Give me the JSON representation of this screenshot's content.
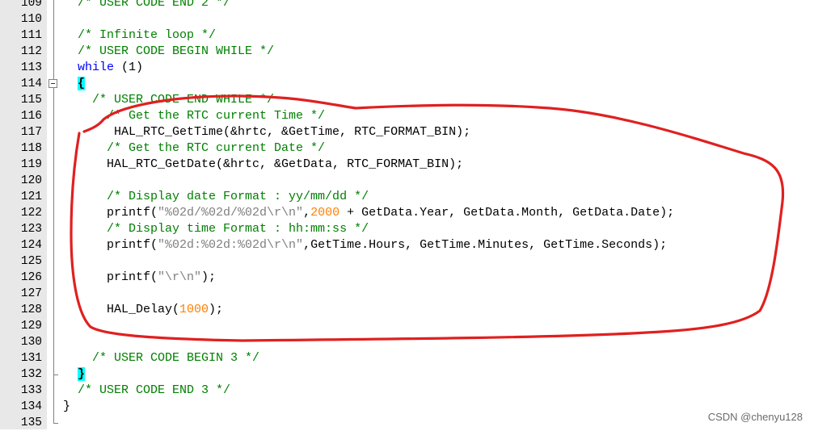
{
  "lines": [
    {
      "num": "109",
      "indent": "  ",
      "html": [
        {
          "c": "cm",
          "t": "/* USER CODE END 2 */"
        }
      ]
    },
    {
      "num": "110",
      "indent": "",
      "html": []
    },
    {
      "num": "111",
      "indent": "  ",
      "html": [
        {
          "c": "cm",
          "t": "/* Infinite loop */"
        }
      ]
    },
    {
      "num": "112",
      "indent": "  ",
      "html": [
        {
          "c": "cm",
          "t": "/* USER CODE BEGIN WHILE */"
        }
      ]
    },
    {
      "num": "113",
      "indent": "  ",
      "html": [
        {
          "c": "kw",
          "t": "while"
        },
        {
          "c": "",
          "t": " (1)"
        }
      ]
    },
    {
      "num": "114",
      "indent": "  ",
      "html": [
        {
          "c": "brace-hl",
          "t": "{"
        }
      ]
    },
    {
      "num": "115",
      "indent": "    ",
      "html": [
        {
          "c": "cm",
          "t": "/* USER CODE END WHILE */"
        }
      ]
    },
    {
      "num": "116",
      "indent": "      ",
      "html": [
        {
          "c": "cm",
          "t": "/* Get the RTC current Time */"
        }
      ]
    },
    {
      "num": "117",
      "indent": "       ",
      "html": [
        {
          "c": "",
          "t": "HAL_RTC_GetTime(&hrtc, &GetTime, RTC_FORMAT_BIN);"
        }
      ]
    },
    {
      "num": "118",
      "indent": "      ",
      "html": [
        {
          "c": "cm",
          "t": "/* Get the RTC current Date */"
        }
      ]
    },
    {
      "num": "119",
      "indent": "      ",
      "html": [
        {
          "c": "",
          "t": "HAL_RTC_GetDate(&hrtc, &GetData, RTC_FORMAT_BIN);"
        }
      ]
    },
    {
      "num": "120",
      "indent": "",
      "html": []
    },
    {
      "num": "121",
      "indent": "      ",
      "html": [
        {
          "c": "cm",
          "t": "/* Display date Format : yy/mm/dd */"
        }
      ]
    },
    {
      "num": "122",
      "indent": "      ",
      "html": [
        {
          "c": "",
          "t": "printf("
        },
        {
          "c": "str",
          "t": "\"%02d/%02d/%02d\\r\\n\""
        },
        {
          "c": "",
          "t": ","
        },
        {
          "c": "num",
          "t": "2000"
        },
        {
          "c": "",
          "t": " + GetData.Year, GetData.Month, GetData.Date);"
        }
      ]
    },
    {
      "num": "123",
      "indent": "      ",
      "html": [
        {
          "c": "cm",
          "t": "/* Display time Format : hh:mm:ss */"
        }
      ]
    },
    {
      "num": "124",
      "indent": "      ",
      "html": [
        {
          "c": "",
          "t": "printf("
        },
        {
          "c": "str",
          "t": "\"%02d:%02d:%02d\\r\\n\""
        },
        {
          "c": "",
          "t": ",GetTime.Hours, GetTime.Minutes, GetTime.Seconds);"
        }
      ]
    },
    {
      "num": "125",
      "indent": "",
      "html": []
    },
    {
      "num": "126",
      "indent": "      ",
      "html": [
        {
          "c": "",
          "t": "printf("
        },
        {
          "c": "str",
          "t": "\"\\r\\n\""
        },
        {
          "c": "",
          "t": ");"
        }
      ]
    },
    {
      "num": "127",
      "indent": "",
      "html": []
    },
    {
      "num": "128",
      "indent": "      ",
      "html": [
        {
          "c": "",
          "t": "HAL_Delay("
        },
        {
          "c": "num",
          "t": "1000"
        },
        {
          "c": "",
          "t": ");"
        }
      ]
    },
    {
      "num": "129",
      "indent": "",
      "html": []
    },
    {
      "num": "130",
      "indent": "",
      "html": []
    },
    {
      "num": "131",
      "indent": "    ",
      "html": [
        {
          "c": "cm",
          "t": "/* USER CODE BEGIN 3 */"
        }
      ]
    },
    {
      "num": "132",
      "indent": "  ",
      "html": [
        {
          "c": "brace-hl",
          "t": "}"
        }
      ]
    },
    {
      "num": "133",
      "indent": "  ",
      "html": [
        {
          "c": "cm",
          "t": "/* USER CODE END 3 */"
        }
      ]
    },
    {
      "num": "134",
      "indent": "",
      "html": [
        {
          "c": "",
          "t": "}"
        }
      ]
    },
    {
      "num": "135",
      "indent": "",
      "html": []
    }
  ],
  "colors": {
    "comment": "#008000",
    "keyword": "#0000ff",
    "string": "#808080",
    "number": "#ff8000",
    "brace_highlight": "#00ffff",
    "annotation": "#e02020"
  },
  "watermark": "CSDN @chenyu128"
}
